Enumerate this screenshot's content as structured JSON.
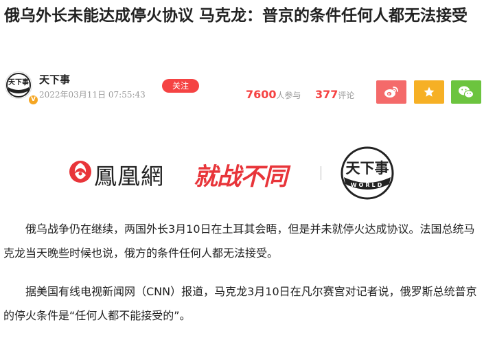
{
  "article": {
    "title": "俄乌外长未能达成停火协议 马克龙：普京的条件任何人都无法接受"
  },
  "author": {
    "name": "天下事",
    "avatar_icon": "tianxiashi-world-logo",
    "verified_badge": "V",
    "publish_time": "2022年03月11日 07:55:43",
    "follow_label": "关注"
  },
  "stats": {
    "participants_count": "7600",
    "participants_label": "人参与",
    "comments_count": "377",
    "comments_label": "评论"
  },
  "share": {
    "weibo_icon": "weibo-icon",
    "favorite_icon": "star-icon",
    "wechat_icon": "wechat-icon",
    "colors": {
      "weibo": "#f46a6a",
      "favorite": "#f6b025",
      "wechat": "#6cc43f"
    }
  },
  "banner": {
    "ifeng_wordmark": "鳳凰網",
    "column_slogan": "就战不同",
    "tianxiashi_logo_text": "天下事",
    "tianxiashi_logo_subtext": "WORLD"
  },
  "body": {
    "paragraphs": [
      "俄乌战争仍在继续，两国外长3月10日在土耳其会晤，但是并未就停火达成协议。法国总统马克龙当天晚些时候也说，俄方的条件任何人都无法接受。",
      "据美国有线电视新闻网（CNN）报道，马克龙3月10日在凡尔赛宫对记者说，俄罗斯总统普京的停火条件是“任何人都不能接受的”。"
    ]
  },
  "colors": {
    "accent_red": "#f54343",
    "text": "#222222",
    "muted": "#999999"
  }
}
